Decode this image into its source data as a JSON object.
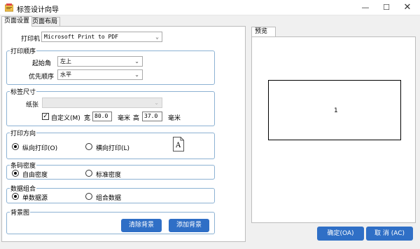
{
  "window": {
    "title": "标签设计向导",
    "min_glyph": "—",
    "max_glyph": "☐",
    "close_glyph": "✕"
  },
  "tabs": [
    {
      "label": "页面设置",
      "active": true
    },
    {
      "label": "页面布局",
      "active": false
    }
  ],
  "printer": {
    "label": "打印机",
    "value": "Microsoft Print to PDF"
  },
  "print_order": {
    "title": "打印顺序",
    "start_corner": {
      "label": "起始角",
      "value": "左上"
    },
    "priority": {
      "label": "优先顺序",
      "value": "水平"
    }
  },
  "label_size": {
    "title": "标签尺寸",
    "paper": {
      "label": "纸张",
      "value": ""
    },
    "custom": {
      "checked": true,
      "check_glyph": "✓",
      "label": "自定义(M)"
    },
    "width": {
      "label": "宽",
      "value": "80.0",
      "unit": "毫米"
    },
    "height": {
      "label": "高",
      "value": "37.0",
      "unit": "毫米"
    }
  },
  "print_direction": {
    "title": "打印方向",
    "portrait": {
      "label": "纵向打印(O)",
      "checked": true
    },
    "landscape": {
      "label": "横向打印(L)",
      "checked": false
    },
    "icon_letter": "A"
  },
  "barcode_density": {
    "title": "条码密度",
    "custom": {
      "label": "自由密度",
      "checked": true
    },
    "standard": {
      "label": "标准密度",
      "checked": false
    }
  },
  "data_combine": {
    "title": "数据组合",
    "single": {
      "label": "单数据源",
      "checked": true
    },
    "combined": {
      "label": "组合数据",
      "checked": false
    }
  },
  "background": {
    "title": "背景图",
    "clear_label": "清除背景",
    "add_label": "添加背景"
  },
  "preview": {
    "tab_label": "预览",
    "label_number": "1"
  },
  "footer": {
    "ok_label": "确定(OA)",
    "cancel_label": "取 消 (AC)"
  },
  "colors": {
    "accent": "#2f6fc6",
    "group_border": "#8db2d3"
  }
}
